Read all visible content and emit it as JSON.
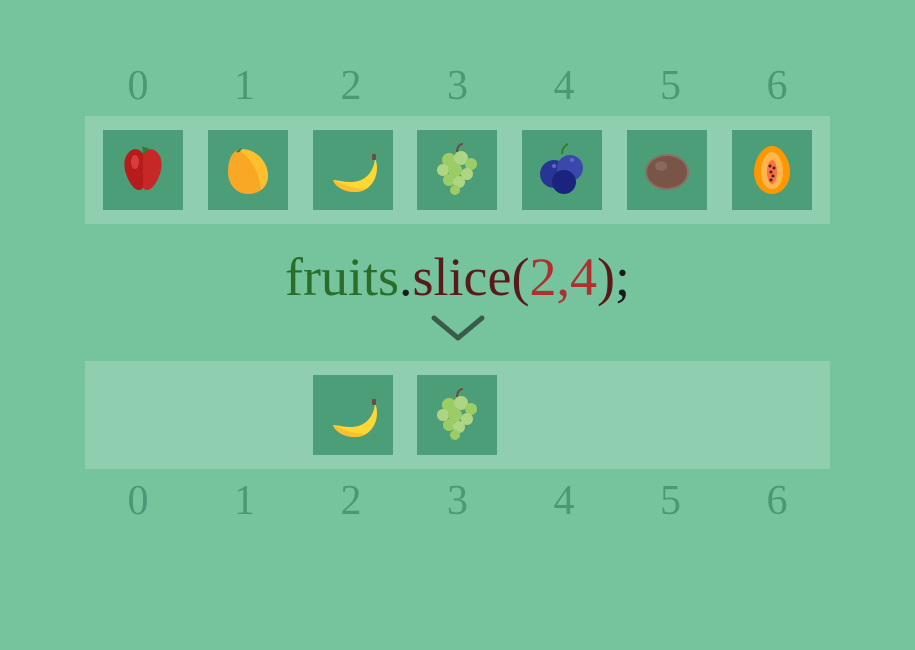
{
  "indices_top": [
    "0",
    "1",
    "2",
    "3",
    "4",
    "5",
    "6"
  ],
  "indices_bottom": [
    "0",
    "1",
    "2",
    "3",
    "4",
    "5",
    "6"
  ],
  "fruits": [
    {
      "name": "apple",
      "glyph": "🍎"
    },
    {
      "name": "mango",
      "glyph": "🥭"
    },
    {
      "name": "banana",
      "glyph": "🍌"
    },
    {
      "name": "grapes",
      "glyph": "🍇"
    },
    {
      "name": "blueberries",
      "glyph": "🫐"
    },
    {
      "name": "kiwi",
      "glyph": "🥝"
    },
    {
      "name": "papaya",
      "glyph": "🥭"
    }
  ],
  "code": {
    "obj": "fruits",
    "dot": ".",
    "method": "slice",
    "paren_open": "(",
    "args": "2,4",
    "paren_close": ")",
    "semi": ";"
  },
  "slice_start": 2,
  "slice_end": 4,
  "result_fruits": [
    {
      "name": "banana",
      "glyph": "🍌"
    },
    {
      "name": "grapes",
      "glyph": "🍇"
    }
  ]
}
